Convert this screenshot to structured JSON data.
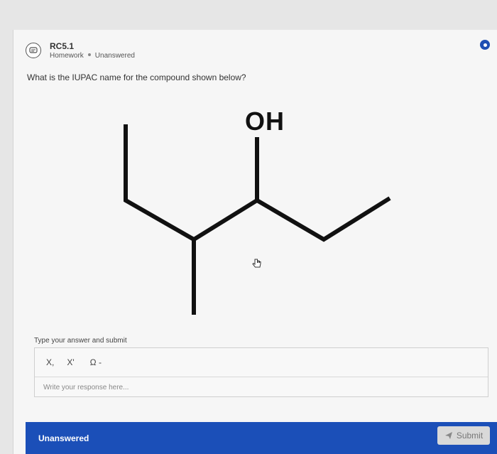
{
  "header": {
    "title": "RC5.1",
    "category": "Homework",
    "status": "Unanswered"
  },
  "question": {
    "text": "What is the IUPAC name for the compound shown below?",
    "structure_label": "OH"
  },
  "answer": {
    "label": "Type your answer and submit",
    "toolbar": {
      "subscript": "X,",
      "superscript": "X'",
      "symbols": "Ω -"
    },
    "placeholder": "Write your response here..."
  },
  "footer": {
    "status": "Unanswered",
    "submit_label": "Submit",
    "bar_color": "#1b4fb8"
  }
}
